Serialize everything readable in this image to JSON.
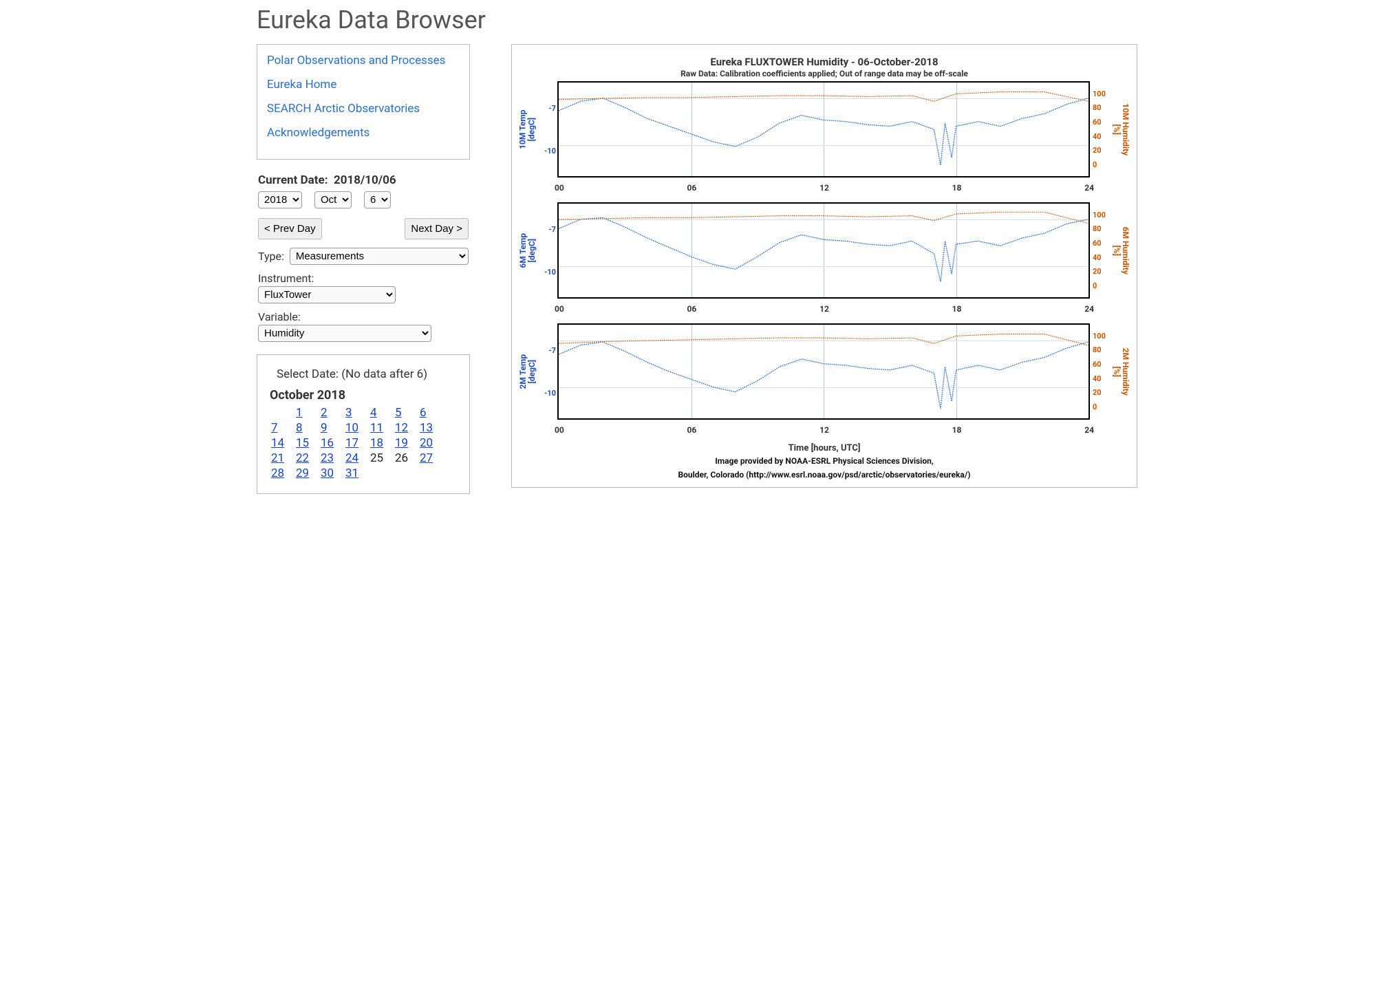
{
  "page": {
    "title": "Eureka Data Browser"
  },
  "nav": {
    "links": [
      "Polar Observations and Processes",
      "Eureka Home",
      "SEARCH Arctic Observatories",
      "Acknowledgements"
    ]
  },
  "date_controls": {
    "label": "Current Date:",
    "current": "2018/10/06",
    "year_options": [
      "2018"
    ],
    "year_selected": "2018",
    "month_options": [
      "Oct"
    ],
    "month_selected": "Oct",
    "day_options": [
      "6"
    ],
    "day_selected": "6",
    "prev_label": "< Prev Day",
    "next_label": "Next Day >"
  },
  "filters": {
    "type_label": "Type:",
    "type_selected": "Measurements",
    "instrument_label": "Instrument:",
    "instrument_selected": "FluxTower",
    "variable_label": "Variable:",
    "variable_selected": "Humidity"
  },
  "calendar": {
    "heading": "Select Date: (No data after 6)",
    "month_label": "October 2018",
    "rows": [
      [
        null,
        1,
        2,
        3,
        4,
        5,
        6
      ],
      [
        7,
        8,
        9,
        10,
        11,
        12,
        13
      ],
      [
        14,
        15,
        16,
        17,
        18,
        19,
        20
      ],
      [
        21,
        22,
        23,
        24,
        25,
        26,
        27
      ],
      [
        28,
        29,
        30,
        31,
        null,
        null,
        null
      ]
    ],
    "nolink_days": [
      25,
      26
    ]
  },
  "chart": {
    "title": "Eureka FLUXTOWER Humidity - 06-October-2018",
    "subtitle": "Raw Data: Calibration coefficients applied; Out of range data may be off-scale",
    "xlabel": "Time [hours, UTC]",
    "credit1": "Image provided by NOAA-ESRL Physical Sciences Division,",
    "credit2": "Boulder, Colorado (http://www.esrl.noaa.gov/psd/arctic/observatories/eureka/)",
    "x_ticks": [
      "00",
      "06",
      "12",
      "18",
      "24"
    ]
  },
  "chart_data": [
    {
      "type": "line",
      "panel": "10M",
      "left_axis_label": "10M Temp\n[degC]",
      "right_axis_label": "10M Humidity\n[%]",
      "x_range": [
        0,
        24
      ],
      "left_y_ticks": [
        -7,
        -10
      ],
      "right_y_ticks": [
        100,
        80,
        60,
        40,
        20,
        0
      ],
      "series": [
        {
          "name": "10M Temp [degC]",
          "axis": "left",
          "color": "#2a6fc9",
          "x": [
            0,
            1,
            2,
            3,
            4,
            5,
            6,
            7,
            8,
            9,
            10,
            11,
            12,
            13,
            14,
            15,
            16,
            17,
            17.3,
            17.5,
            17.8,
            18,
            19,
            20,
            21,
            22,
            23,
            24
          ],
          "y": [
            -7.8,
            -7.2,
            -7.0,
            -7.6,
            -8.3,
            -8.8,
            -9.3,
            -9.8,
            -10.1,
            -9.5,
            -8.6,
            -8.1,
            -8.4,
            -8.5,
            -8.7,
            -8.8,
            -8.5,
            -9.0,
            -11.3,
            -8.6,
            -10.8,
            -8.8,
            -8.5,
            -8.8,
            -8.3,
            -8.0,
            -7.4,
            -7.0
          ]
        },
        {
          "name": "10M Humidity [%]",
          "axis": "right",
          "color": "#cc5500",
          "x": [
            0,
            2,
            4,
            6,
            8,
            10,
            12,
            14,
            16,
            17,
            18,
            20,
            22,
            24
          ],
          "y": [
            82,
            83,
            84,
            84,
            85,
            86,
            86,
            85,
            86,
            80,
            88,
            90,
            90,
            80
          ]
        }
      ]
    },
    {
      "type": "line",
      "panel": "6M",
      "left_axis_label": "6M Temp\n[degC]",
      "right_axis_label": "6M Humidity\n[%]",
      "x_range": [
        0,
        24
      ],
      "left_y_ticks": [
        -7,
        -10
      ],
      "right_y_ticks": [
        100,
        80,
        60,
        40,
        20,
        0
      ],
      "series": [
        {
          "name": "6M Temp [degC]",
          "axis": "left",
          "color": "#2a6fc9",
          "x": [
            0,
            1,
            2,
            3,
            4,
            5,
            6,
            7,
            8,
            9,
            10,
            11,
            12,
            13,
            14,
            15,
            16,
            17,
            17.3,
            17.5,
            17.8,
            18,
            19,
            20,
            21,
            22,
            23,
            24
          ],
          "y": [
            -7.6,
            -7.0,
            -6.9,
            -7.5,
            -8.2,
            -8.8,
            -9.4,
            -9.9,
            -10.2,
            -9.4,
            -8.5,
            -8.0,
            -8.3,
            -8.4,
            -8.6,
            -8.7,
            -8.4,
            -9.2,
            -11.0,
            -8.4,
            -10.5,
            -8.6,
            -8.4,
            -8.7,
            -8.2,
            -7.9,
            -7.3,
            -7.0
          ]
        },
        {
          "name": "6M Humidity [%]",
          "axis": "right",
          "color": "#cc5500",
          "x": [
            0,
            2,
            4,
            6,
            8,
            10,
            12,
            14,
            16,
            17,
            18,
            20,
            22,
            24
          ],
          "y": [
            83,
            84,
            85,
            85,
            86,
            87,
            87,
            86,
            87,
            82,
            89,
            91,
            91,
            79
          ]
        }
      ]
    },
    {
      "type": "line",
      "panel": "2M",
      "left_axis_label": "2M Temp\n[degC]",
      "right_axis_label": "2M Humidity\n[%]",
      "x_range": [
        0,
        24
      ],
      "left_y_ticks": [
        -7,
        -10
      ],
      "right_y_ticks": [
        100,
        80,
        60,
        40,
        20,
        0
      ],
      "series": [
        {
          "name": "2M Temp [degC]",
          "axis": "left",
          "color": "#2a6fc9",
          "x": [
            0,
            1,
            2,
            3,
            4,
            5,
            6,
            7,
            8,
            9,
            10,
            11,
            12,
            13,
            14,
            15,
            16,
            17,
            17.3,
            17.5,
            17.8,
            18,
            19,
            20,
            21,
            22,
            23,
            24
          ],
          "y": [
            -7.9,
            -7.3,
            -7.1,
            -7.7,
            -8.4,
            -9.0,
            -9.5,
            -10.0,
            -10.3,
            -9.6,
            -8.7,
            -8.2,
            -8.5,
            -8.6,
            -8.8,
            -8.9,
            -8.6,
            -9.1,
            -11.4,
            -8.7,
            -10.9,
            -8.9,
            -8.6,
            -8.9,
            -8.4,
            -8.1,
            -7.5,
            -7.1
          ]
        },
        {
          "name": "2M Humidity [%]",
          "axis": "right",
          "color": "#cc5500",
          "x": [
            0,
            2,
            4,
            6,
            8,
            10,
            12,
            14,
            16,
            17,
            18,
            20,
            22,
            24
          ],
          "y": [
            80,
            82,
            83,
            84,
            85,
            86,
            86,
            85,
            86,
            80,
            88,
            90,
            90,
            78
          ]
        }
      ]
    }
  ]
}
